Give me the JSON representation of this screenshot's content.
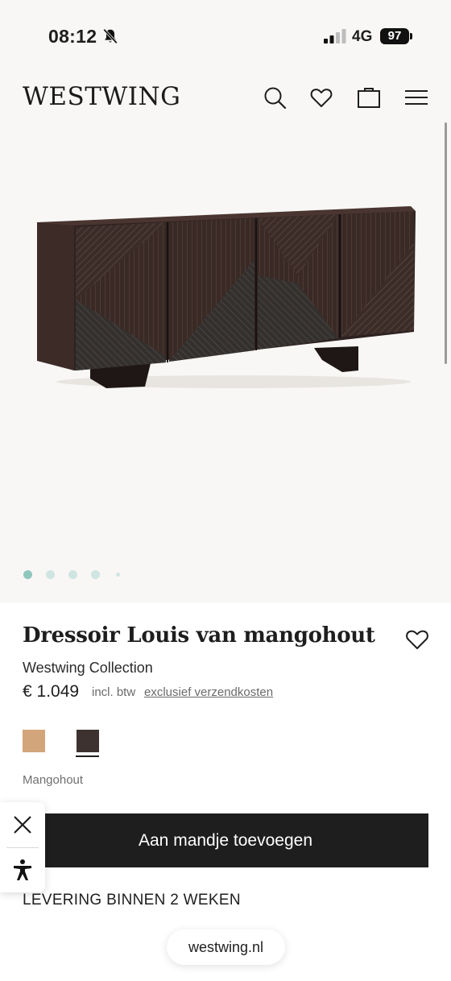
{
  "status_bar": {
    "time": "08:12",
    "network": "4G",
    "battery": "97",
    "icons": [
      "bell-muted-icon",
      "signal-icon",
      "battery-icon"
    ]
  },
  "header": {
    "logo": "WESTWING",
    "icons": [
      "search-icon",
      "heart-icon",
      "bag-icon",
      "menu-icon"
    ]
  },
  "gallery": {
    "image": "dark wooden sideboard with diagonal ribbed door panels",
    "dots_count": 5,
    "active_dot": 1
  },
  "product": {
    "title": "Dressoir Louis van mangohout",
    "brand": "Westwing Collection",
    "price": "€ 1.049",
    "vat": "incl. btw",
    "shipping_link": "exclusief verzendkosten",
    "material": "Mangohout",
    "swatches": [
      {
        "color": "#d3a57b",
        "selected": false
      },
      {
        "color": "#3e3230",
        "selected": true
      }
    ]
  },
  "actions": {
    "add_to_cart": "Aan mandje toevoegen",
    "delivery": "LEVERING BINNEN 2 WEKEN"
  },
  "floating_panel": {
    "icons": [
      "close-icon",
      "accessibility-icon"
    ]
  },
  "browser": {
    "url": "westwing.nl"
  },
  "colors": {
    "background_top": "#f8f7f5",
    "text": "#1e1e1e",
    "button": "#1e1e1e",
    "dot_active": "#8fc7bd",
    "dot_inactive": "#cfe5e1"
  }
}
